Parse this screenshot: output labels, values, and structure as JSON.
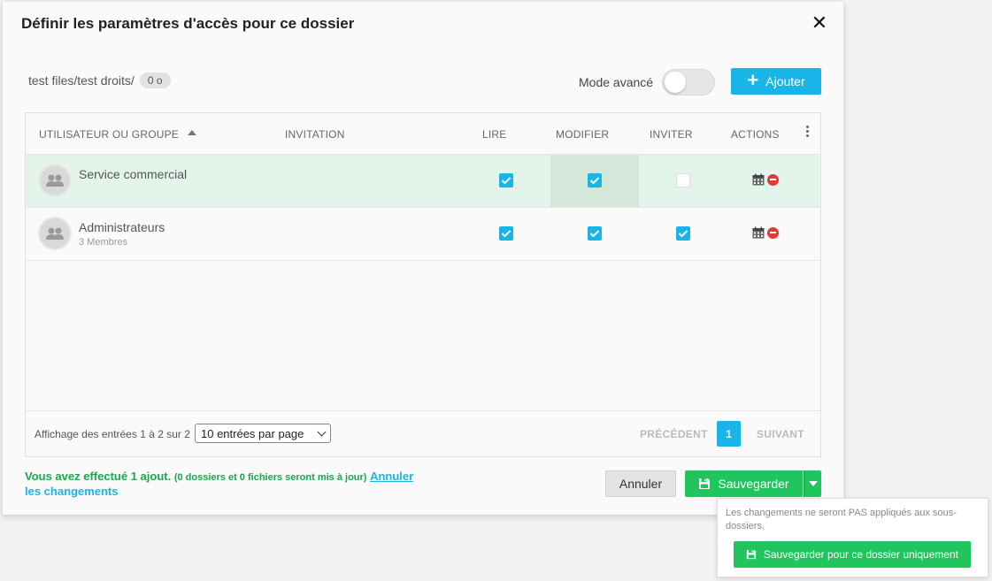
{
  "dialog": {
    "title": "Définir les paramètres d'accès pour ce dossier",
    "close_icon": "close-icon"
  },
  "path": {
    "text": "test files/test droits/",
    "size": "0 o"
  },
  "advanced_mode": {
    "label": "Mode avancé",
    "enabled": false
  },
  "add_button": {
    "label": "Ajouter",
    "icon": "plus-icon"
  },
  "table": {
    "headers": {
      "user": "UTILISATEUR OU GROUPE",
      "invitation": "INVITATION",
      "read": "LIRE",
      "modify": "MODIFIER",
      "invite": "INVITER",
      "actions": "ACTIONS"
    },
    "sort_column": "user",
    "sort_direction": "ascending",
    "rows": [
      {
        "name": "Service commercial",
        "subtitle": "",
        "read": true,
        "modify": true,
        "invite": false,
        "highlighted": true
      },
      {
        "name": "Administrateurs",
        "subtitle": "3 Membres",
        "read": true,
        "modify": true,
        "invite": true,
        "highlighted": false
      }
    ],
    "footer": {
      "info": "Affichage des entrées 1 à 2 sur 2",
      "page_size": "10 entrées par page",
      "prev": "PRÉCÉDENT",
      "current_page": "1",
      "next": "SUIVANT"
    }
  },
  "summary": {
    "main": "Vous avez effectué 1 ajout.",
    "detail": "(0 dossiers et 0 fichiers seront mis à jour)",
    "undo_link": "Annuler",
    "undo_rest": "les changements"
  },
  "buttons": {
    "cancel": "Annuler",
    "save": "Sauvegarder",
    "save_icon": "floppy-disk-icon"
  },
  "popover": {
    "text": "Les changements ne seront PAS appliqués aux sous-dossiers.",
    "button": "Sauvegarder pour ce dossier uniquement"
  },
  "colors": {
    "accent": "#1ab5e8",
    "success": "#21c55d",
    "danger": "#e53935",
    "row_highlight": "#e3f4ea"
  }
}
